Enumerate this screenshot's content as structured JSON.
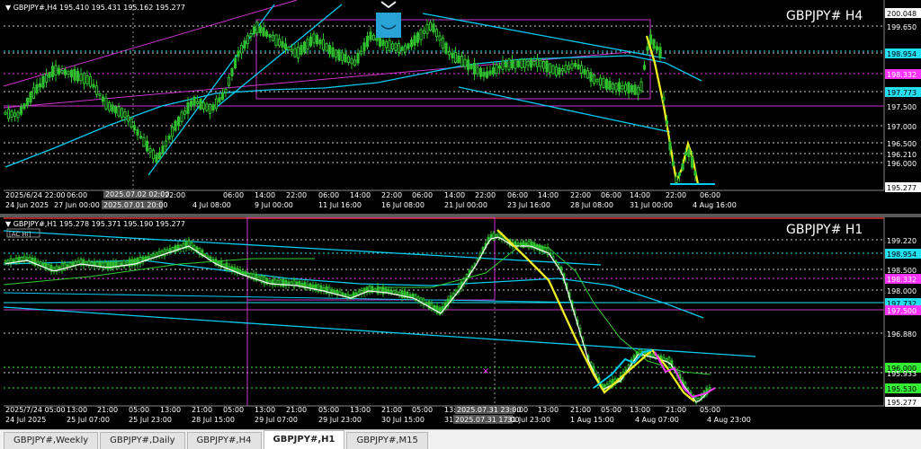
{
  "colors": {
    "background": "#000000",
    "candle": "#2fbf2f",
    "channel": "#00ccee",
    "purple": "#cc33cc",
    "yellow": "#eeee22",
    "white": "#ffffff",
    "magentaLabel": "#ff33ff",
    "cyanLabel": "#22e0f0",
    "greenLabel": "#33ee33"
  },
  "chart_h4": {
    "header": "▼ GBPJPY#,H4  195.410 195.431 195.162 195.277",
    "title": "GBPJPY#  H4",
    "icon": "smile-bowl-icon",
    "price_labels": [
      {
        "text": "200.048",
        "type": "box"
      },
      {
        "text": "199.650",
        "type": "plain"
      },
      {
        "text": "198.954",
        "type": "cyan"
      },
      {
        "text": "198.332",
        "type": "magenta"
      },
      {
        "text": "197.773",
        "type": "cyan"
      },
      {
        "text": "197.500",
        "type": "plain"
      },
      {
        "text": "197.000",
        "type": "plain"
      },
      {
        "text": "196.500",
        "type": "plain"
      },
      {
        "text": "196.210",
        "type": "plain"
      },
      {
        "text": "196.000",
        "type": "plain"
      },
      {
        "text": "195.277",
        "type": "box"
      }
    ],
    "time_labels": [
      "2025/6/24 22:00",
      "06:00",
      "14:00",
      "22:00",
      "06:00",
      "14:00",
      "22:00",
      "06:00",
      "14:00",
      "22:00",
      "06:00",
      "14:00",
      "22:00",
      "06:00",
      "14:00",
      "22:00",
      "06:00",
      "14:00",
      "22:00",
      "06:00",
      "14:00",
      "22:00"
    ],
    "date_labels": [
      "24 Jun 2025",
      "27 Jun 00:00",
      "2025.07.01 20:00",
      "4 Jul 08:00",
      "9 Jul 00:00",
      "11 Jul 16:00",
      "16 Jul 08:00",
      "21 Jul 00:00",
      "23 Jul 16:00",
      "28 Jul 08:00",
      "31 Jul 00:00",
      "4 Aug 16:00"
    ],
    "crosshair_labels": [
      "2025.07.02 02:00"
    ]
  },
  "chart_h1": {
    "header": "▼ GBPJPY#,H1  195.278 195.371 195.190 195.277",
    "indicator": "[AC Hi]",
    "title": "GBPJPY#  H1",
    "price_labels": [
      {
        "text": "199.220",
        "type": "plain"
      },
      {
        "text": "198.954",
        "type": "cyan"
      },
      {
        "text": "198.500",
        "type": "plain"
      },
      {
        "text": "198.332",
        "type": "magenta"
      },
      {
        "text": "198.000",
        "type": "plain"
      },
      {
        "text": "197.732",
        "type": "cyan"
      },
      {
        "text": "197.500",
        "type": "magenta"
      },
      {
        "text": "196.880",
        "type": "plain"
      },
      {
        "text": "196.000",
        "type": "green"
      },
      {
        "text": "195.933",
        "type": "plain"
      },
      {
        "text": "195.530",
        "type": "green"
      },
      {
        "text": "195.277",
        "type": "box"
      }
    ],
    "time_labels": [
      "2025/7/24 05:00",
      "13:00",
      "21:00",
      "05:00",
      "13:00",
      "21:00",
      "05:00",
      "13:00",
      "21:00",
      "05:00",
      "13:00",
      "21:00",
      "05:00",
      "13:00",
      "21:00",
      "05:00",
      "13:00",
      "21:00",
      "05:00",
      "13:00",
      "21:00",
      "05:00"
    ],
    "date_labels": [
      "24 Jul 2025",
      "25 Jul 07:00",
      "25 Jul 23:00",
      "28 Jul 15:00",
      "29 Jul 07:00",
      "29 Jul 23:00",
      "30 Jul 15:00",
      "31",
      "2025.07.31 17:00",
      "31 Jul 23:00",
      "1 Aug 15:00",
      "4 Aug 07:00",
      "4 Aug 23:00"
    ],
    "crosshair_labels": [
      "2025.07.31 23:00"
    ]
  },
  "tabs": [
    {
      "label": "GBPJPY#,Weekly",
      "active": false
    },
    {
      "label": "GBPJPY#,Daily",
      "active": false
    },
    {
      "label": "GBPJPY#,H4",
      "active": false
    },
    {
      "label": "GBPJPY#,H1",
      "active": true
    },
    {
      "label": "GBPJPY#,M15",
      "active": false
    }
  ]
}
